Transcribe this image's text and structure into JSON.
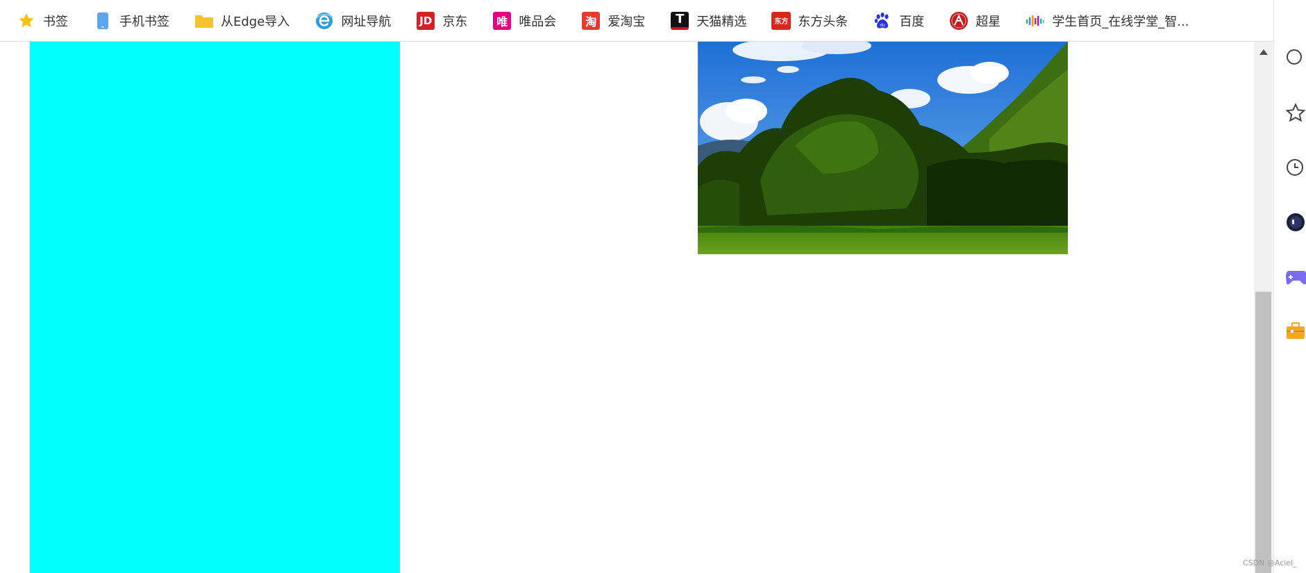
{
  "bookmarks": [
    {
      "label": "书签",
      "icon": "star-icon"
    },
    {
      "label": "手机书签",
      "icon": "phone-icon"
    },
    {
      "label": "从Edge导入",
      "icon": "folder-icon"
    },
    {
      "label": "网址导航",
      "icon": "ie-e-icon"
    },
    {
      "label": "京东",
      "icon": "jd-logo-icon",
      "badge": "JD"
    },
    {
      "label": "唯品会",
      "icon": "vip-logo-icon",
      "badge": "唯"
    },
    {
      "label": "爱淘宝",
      "icon": "taobao-logo-icon",
      "badge": "淘"
    },
    {
      "label": "天猫精选",
      "icon": "tmall-logo-icon",
      "badge": "T"
    },
    {
      "label": "东方头条",
      "icon": "dongfang-logo-icon",
      "badge": "东方"
    },
    {
      "label": "百度",
      "icon": "baidu-paw-icon"
    },
    {
      "label": "超星",
      "icon": "chaoxing-logo-icon"
    },
    {
      "label": "学生首页_在线学堂_智...",
      "icon": "xuetang-bars-icon"
    }
  ],
  "content": {
    "cyan_color": "#00ffff"
  },
  "watermark": "CSDN @Aciel_",
  "side_panel": [
    {
      "icon": "search-icon"
    },
    {
      "icon": "star-outline-icon"
    },
    {
      "icon": "clock-icon"
    },
    {
      "icon": "assistant-orb-icon"
    },
    {
      "icon": "gamepad-icon"
    },
    {
      "icon": "toolbox-icon"
    }
  ],
  "colors": {
    "jd": "#d71f2c",
    "vip": "#e4007f",
    "taobao": "#e33b2e",
    "tmall": "#d60b20",
    "dongfang": "#d9271b",
    "baidu": "#2932e1",
    "chaoxing": "#c01f1f",
    "folder": "#f7c32c",
    "phone": "#5aa6f2",
    "star": "#fbbf14"
  }
}
